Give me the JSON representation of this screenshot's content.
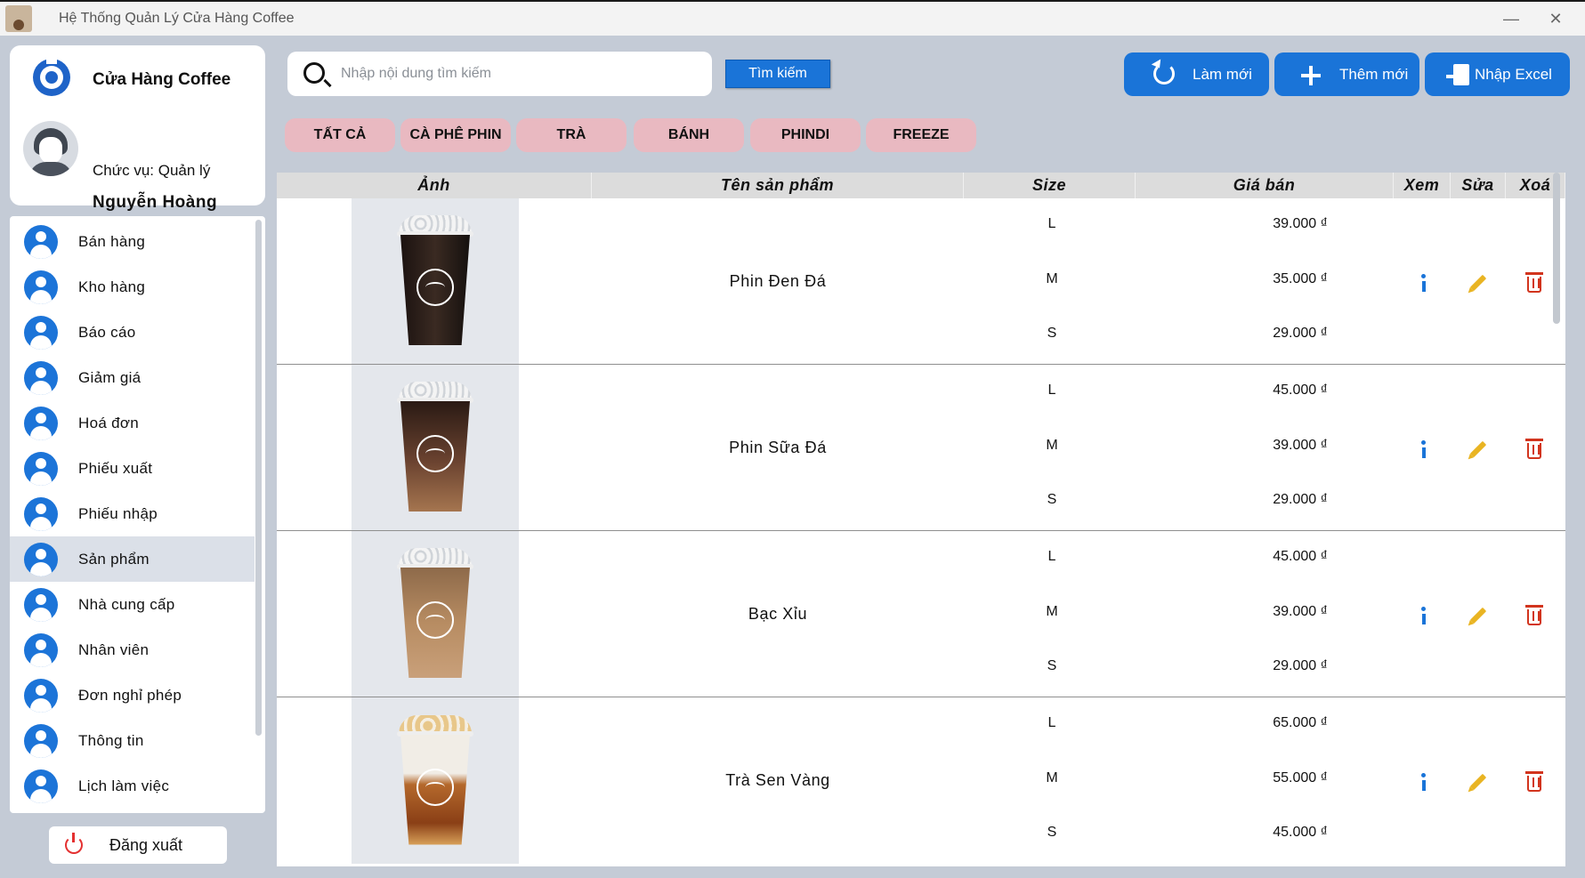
{
  "window": {
    "title": "Hệ Thống Quản Lý Cửa Hàng Coffee",
    "minimize_glyph": "—",
    "close_glyph": "✕"
  },
  "profile": {
    "store_name": "Cửa Hàng Coffee",
    "role": "Chức vụ: Quản lý",
    "user_name": "Nguyễn Hoàng Long"
  },
  "sidebar": {
    "items": [
      {
        "label": "Bán hàng",
        "icon": "user-circle-icon"
      },
      {
        "label": "Kho hàng",
        "icon": "user-circle-icon"
      },
      {
        "label": "Báo cáo",
        "icon": "user-circle-icon"
      },
      {
        "label": "Giảm giá",
        "icon": "user-circle-icon"
      },
      {
        "label": "Hoá đơn",
        "icon": "user-circle-icon"
      },
      {
        "label": "Phiếu xuất",
        "icon": "user-circle-icon"
      },
      {
        "label": "Phiếu nhập",
        "icon": "user-circle-icon"
      },
      {
        "label": "Sản phẩm",
        "icon": "user-circle-icon",
        "active": true
      },
      {
        "label": "Nhà cung cấp",
        "icon": "user-circle-icon"
      },
      {
        "label": "Nhân viên",
        "icon": "user-circle-icon"
      },
      {
        "label": "Đơn nghỉ phép",
        "icon": "user-circle-icon"
      },
      {
        "label": "Thông tin",
        "icon": "user-circle-icon"
      },
      {
        "label": "Lịch làm việc",
        "icon": "user-circle-icon"
      }
    ],
    "logout_label": "Đăng xuất"
  },
  "toolbar": {
    "search_placeholder": "Nhập nội dung tìm kiếm",
    "search_value": "",
    "search_button": "Tìm kiếm",
    "refresh_label": "Làm mới",
    "add_label": "Thêm mới",
    "import_label": "Nhập Excel"
  },
  "categories": [
    "TẤT CẢ",
    "CÀ PHÊ PHIN",
    "TRÀ",
    "BÁNH",
    "PHINDI",
    "FREEZE"
  ],
  "table": {
    "headers": [
      "Ảnh",
      "Tên sản phẩm",
      "Size",
      "Giá bán",
      "Xem",
      "Sửa",
      "Xoá"
    ],
    "rows": [
      {
        "name": "Phin Đen Đá",
        "sizes": [
          {
            "size": "L",
            "price": "39.000 ₫"
          },
          {
            "size": "M",
            "price": "35.000 ₫"
          },
          {
            "size": "S",
            "price": "29.000 ₫"
          }
        ]
      },
      {
        "name": "Phin Sữa Đá",
        "sizes": [
          {
            "size": "L",
            "price": "45.000 ₫"
          },
          {
            "size": "M",
            "price": "39.000 ₫"
          },
          {
            "size": "S",
            "price": "29.000 ₫"
          }
        ]
      },
      {
        "name": "Bạc Xỉu",
        "sizes": [
          {
            "size": "L",
            "price": "45.000 ₫"
          },
          {
            "size": "M",
            "price": "39.000 ₫"
          },
          {
            "size": "S",
            "price": "29.000 ₫"
          }
        ]
      },
      {
        "name": "Trà Sen Vàng",
        "sizes": [
          {
            "size": "L",
            "price": "65.000 ₫"
          },
          {
            "size": "M",
            "price": "55.000 ₫"
          },
          {
            "size": "S",
            "price": "45.000 ₫"
          }
        ]
      }
    ]
  },
  "colors": {
    "accent": "#1a74d8",
    "chip": "#e9b9c1",
    "edit": "#e9b422",
    "delete": "#d2341d",
    "background": "#c4cbd6"
  }
}
